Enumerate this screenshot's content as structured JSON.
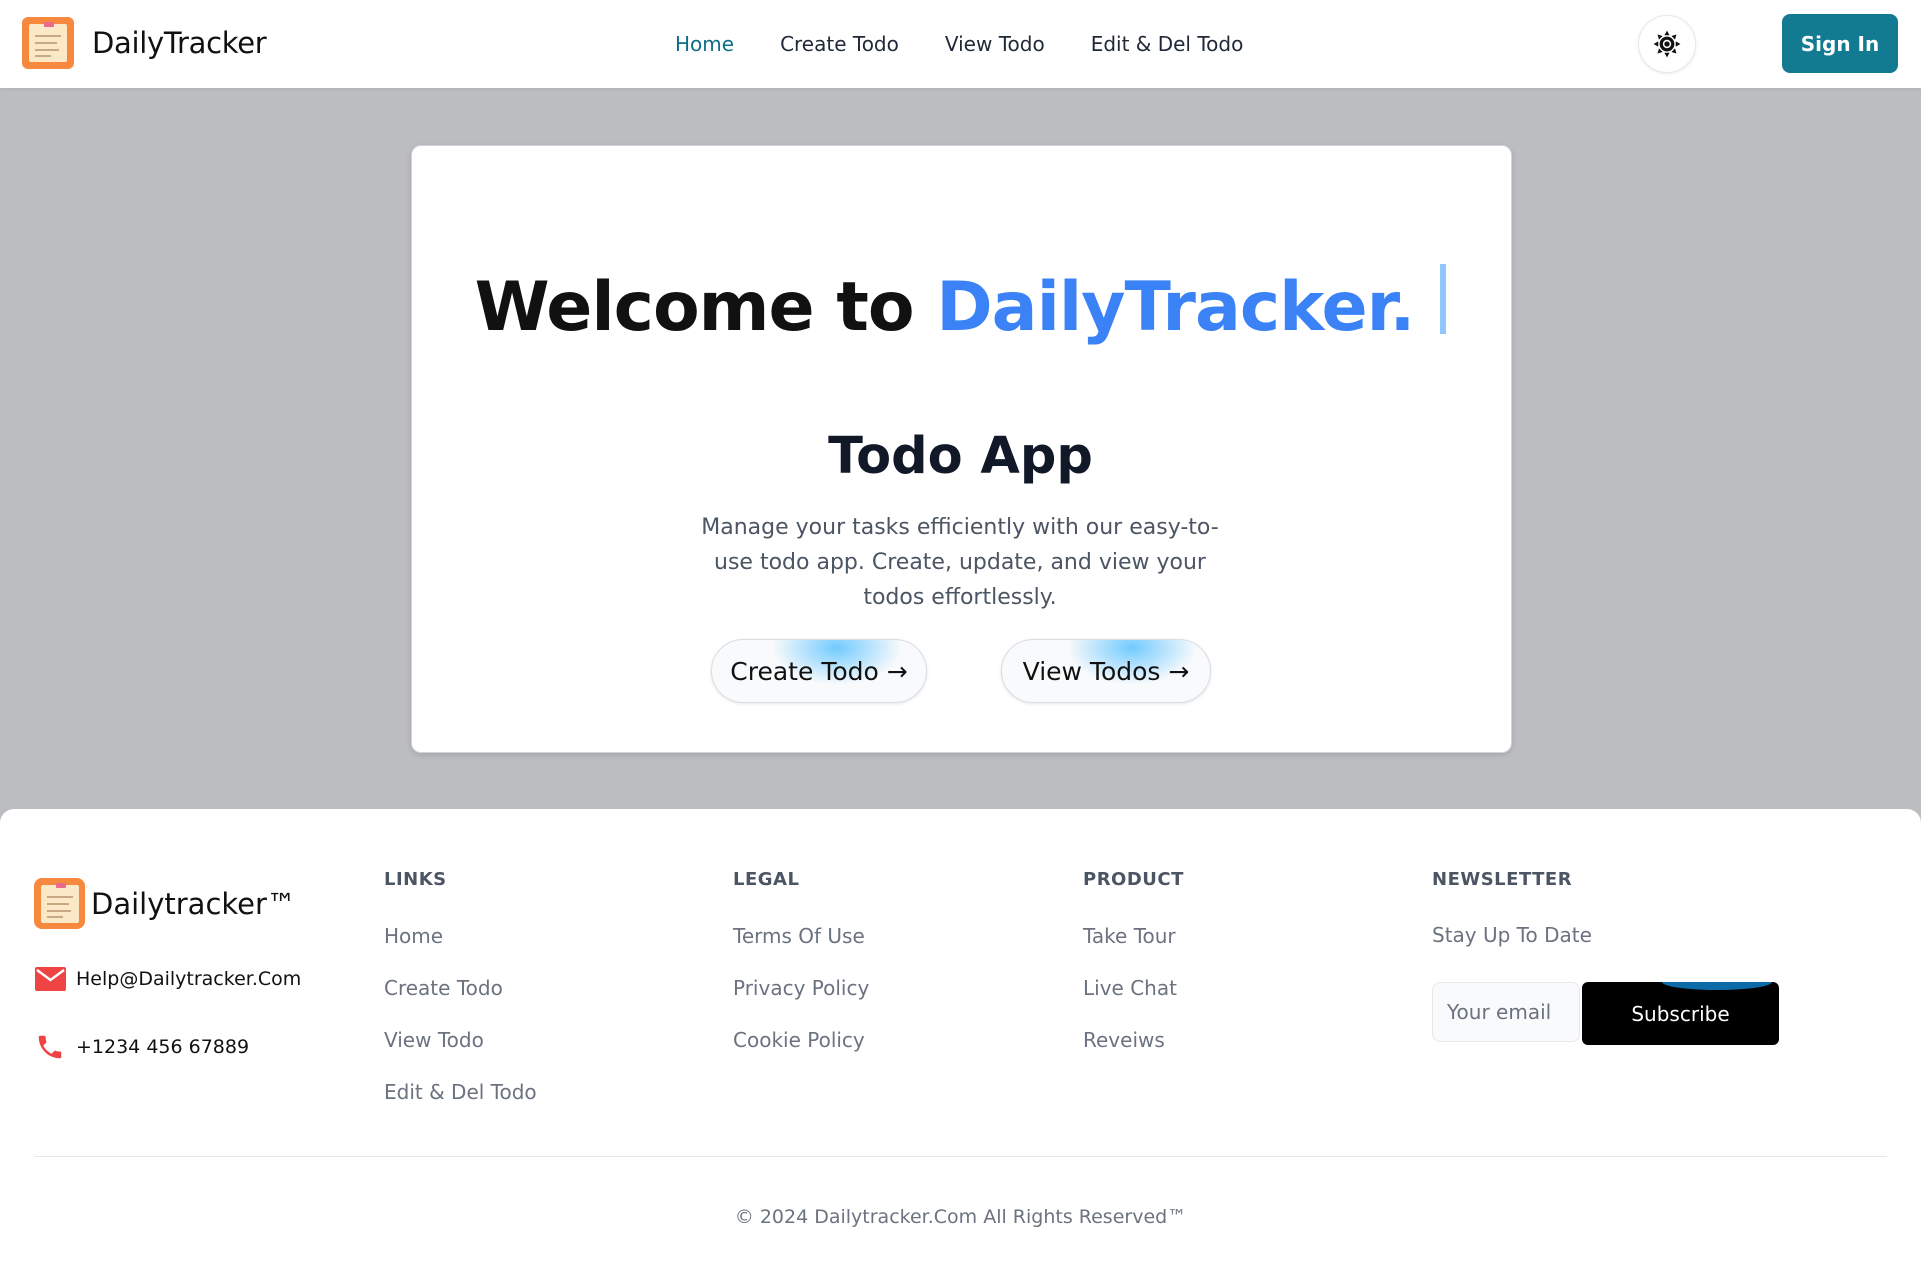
{
  "header": {
    "brand_name": "DailyTracker",
    "nav": [
      {
        "label": "Home",
        "active": true
      },
      {
        "label": "Create Todo"
      },
      {
        "label": "View Todo"
      },
      {
        "label": "Edit & Del Todo"
      }
    ],
    "theme_toggle_icon": "sun-icon",
    "signin_label": "Sign In"
  },
  "hero": {
    "welcome_prefix": "Welcome to ",
    "welcome_accent": "DailyTracker.",
    "title": "Todo App",
    "description": "Manage your tasks efficiently with our easy-to-use todo app. Create, update, and view your todos effortlessly.",
    "create_button": "Create Todo →",
    "view_button": "View Todos →"
  },
  "footer": {
    "brand_name": "Dailytracker™",
    "email": "Help@Dailytracker.Com",
    "phone": "+1234 456 67889",
    "links": {
      "heading": "LINKS",
      "items": [
        "Home",
        "Create Todo",
        "View Todo",
        "Edit & Del Todo"
      ]
    },
    "legal": {
      "heading": "LEGAL",
      "items": [
        "Terms Of Use",
        "Privacy Policy",
        "Cookie Policy"
      ]
    },
    "product": {
      "heading": "PRODUCT",
      "items": [
        "Take Tour",
        "Live Chat",
        "Reveiws"
      ]
    },
    "newsletter": {
      "heading": "NEWSLETTER",
      "text": "Stay Up To Date",
      "email_placeholder": "Your email",
      "subscribe_label": "Subscribe"
    },
    "copyright": "© 2024 Dailytracker.Com All Rights Reserved™"
  },
  "colors": {
    "accent_blue": "#3b82f6",
    "primary_teal": "#127a91",
    "page_background": "#bcbdc1"
  }
}
